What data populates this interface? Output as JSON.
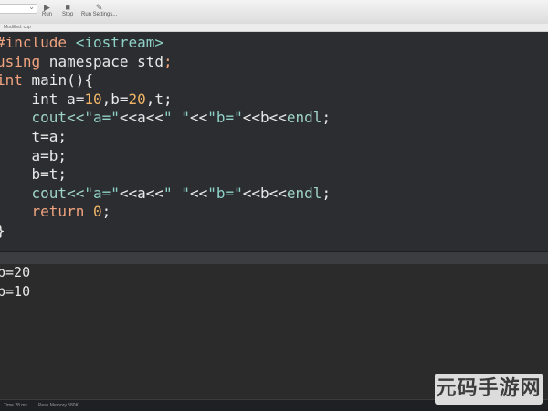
{
  "toolbar": {
    "items": [
      {
        "label": "Run",
        "icon": "play-icon"
      },
      {
        "label": "Stop",
        "icon": "stop-icon"
      },
      {
        "label": "Run Settings...",
        "icon": "wrench-icon"
      }
    ]
  },
  "file_tab": {
    "label": "Modified: cpp"
  },
  "code": {
    "lines": [
      [
        {
          "t": "#include ",
          "c": "inc"
        },
        {
          "t": "<iostream>",
          "c": "str"
        }
      ],
      [
        {
          "t": "using",
          "c": "kw"
        },
        {
          "t": " namespace std",
          "c": "id"
        },
        {
          "t": ";",
          "c": "kw"
        }
      ],
      [
        {
          "t": "int",
          "c": "ty"
        },
        {
          "t": " main(){",
          "c": "id"
        }
      ],
      [
        {
          "t": "    int ",
          "c": "id"
        },
        {
          "t": "a=",
          "c": "id"
        },
        {
          "t": "10",
          "c": "num"
        },
        {
          "t": ",b=",
          "c": "id"
        },
        {
          "t": "20",
          "c": "num"
        },
        {
          "t": ",t;",
          "c": "id"
        }
      ],
      [
        {
          "t": "    cout<<",
          "c": "fn"
        },
        {
          "t": "\"a=\"",
          "c": "str"
        },
        {
          "t": "<<a<<",
          "c": "id"
        },
        {
          "t": "\" \"",
          "c": "str"
        },
        {
          "t": "<<",
          "c": "id"
        },
        {
          "t": "\"b=\"",
          "c": "str"
        },
        {
          "t": "<<b<<",
          "c": "id"
        },
        {
          "t": "endl",
          "c": "fn"
        },
        {
          "t": ";",
          "c": "id"
        }
      ],
      [
        {
          "t": "    t=a;",
          "c": "id"
        }
      ],
      [
        {
          "t": "    a=b;",
          "c": "id"
        }
      ],
      [
        {
          "t": "    b=t;",
          "c": "id"
        }
      ],
      [
        {
          "t": "    cout<<",
          "c": "fn"
        },
        {
          "t": "\"a=\"",
          "c": "str"
        },
        {
          "t": "<<a<<",
          "c": "id"
        },
        {
          "t": "\" \"",
          "c": "str"
        },
        {
          "t": "<<",
          "c": "id"
        },
        {
          "t": "\"b=\"",
          "c": "str"
        },
        {
          "t": "<<b<<",
          "c": "id"
        },
        {
          "t": "endl",
          "c": "fn"
        },
        {
          "t": ";",
          "c": "id"
        }
      ],
      [
        {
          "t": "    return ",
          "c": "kw"
        },
        {
          "t": "0",
          "c": "num"
        },
        {
          "t": ";",
          "c": "id"
        }
      ],
      [
        {
          "t": "}",
          "c": "id"
        }
      ]
    ]
  },
  "console": {
    "lines": [
      "b=20",
      "b=10"
    ]
  },
  "status": {
    "time": "Time 28 ms",
    "memory": "Peak Memory 580K"
  },
  "watermark": "元码手游网",
  "colors": {
    "editor_bg": "#2b2d31",
    "keyword": "#f0a37e",
    "string": "#8fd1c7",
    "number": "#f1b466"
  }
}
